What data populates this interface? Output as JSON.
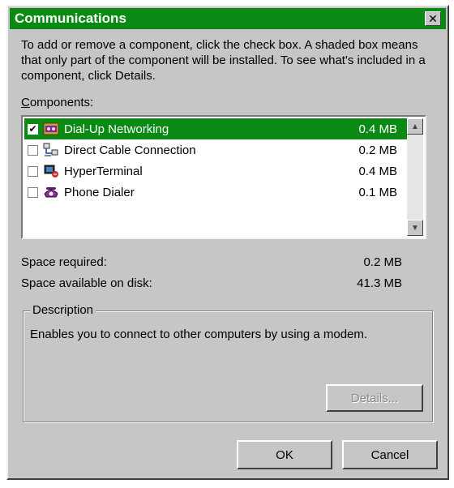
{
  "window": {
    "title": "Communications",
    "close_symbol": "✕"
  },
  "instructions": "To add or remove a component, click the check box. A shaded box means that only part of the component will be installed. To see what's included in a component, click Details.",
  "components_label": {
    "first": "C",
    "rest": "omponents:"
  },
  "components": [
    {
      "name": "Dial-Up Networking",
      "size": "0.4 MB",
      "checked": true,
      "selected": true,
      "icon": "dialup-networking-icon"
    },
    {
      "name": "Direct Cable Connection",
      "size": "0.2 MB",
      "checked": false,
      "selected": false,
      "icon": "direct-cable-icon"
    },
    {
      "name": "HyperTerminal",
      "size": "0.4 MB",
      "checked": false,
      "selected": false,
      "icon": "hyperterminal-icon"
    },
    {
      "name": "Phone Dialer",
      "size": "0.1 MB",
      "checked": false,
      "selected": false,
      "icon": "phone-dialer-icon"
    }
  ],
  "space": {
    "required_label": "Space required:",
    "required_value": "0.2 MB",
    "available_label": "Space available on disk:",
    "available_value": "41.3 MB"
  },
  "description": {
    "legend": "Description",
    "text": "Enables you to connect to other computers by using a modem."
  },
  "buttons": {
    "details": "Details...",
    "ok": "OK",
    "cancel": "Cancel"
  },
  "colors": {
    "accent": "#0a8a14",
    "face": "#c6c6c6"
  }
}
